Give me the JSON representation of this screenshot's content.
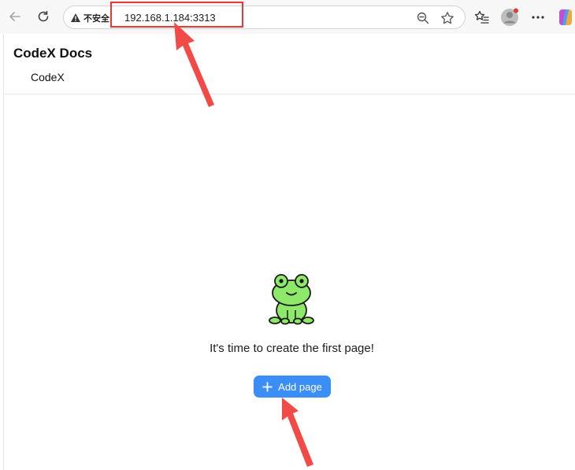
{
  "browser": {
    "insecure_label": "不安全",
    "url": "192.168.1.184:3313"
  },
  "app": {
    "title": "CodeX Docs",
    "nav_link": "CodeX"
  },
  "empty_state": {
    "message": "It's time to create the first page!",
    "button_label": "Add page",
    "illustration": "frog-icon"
  },
  "colors": {
    "accent": "#3a8ef6",
    "annotation": "#e53935"
  }
}
